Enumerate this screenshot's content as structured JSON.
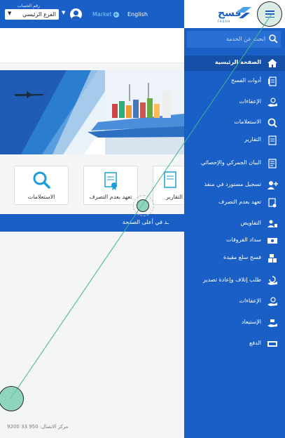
{
  "topbar": {
    "branch_label": "رقم الحساب",
    "branch_value": "الفرع الرئيسي",
    "market_label": "Market",
    "language_label": "English"
  },
  "cards": [
    {
      "label": "الاستعلامات",
      "icon": "search-icon"
    },
    {
      "label": "تعهد بعدم التصرف",
      "icon": "document-ribbon-icon"
    },
    {
      "label": "التقارير",
      "icon": "report-icon"
    }
  ],
  "bluebar": {
    "text": "ـد في أعلى الصفحة"
  },
  "footer": {
    "phone": "مركز الاتصال: 950 33 9200"
  },
  "drawer": {
    "logo_arabic": "فسح",
    "logo_english": "FASAH",
    "search_placeholder": "ابحث عن الخدمة",
    "items": [
      {
        "label": "الصفحة الرئيسية",
        "icon": "home-icon",
        "active": true
      },
      {
        "label": "أدوات الفسح",
        "icon": "tools-doc-icon"
      },
      {
        "label": "الإعفاءات",
        "icon": "hand-coin-icon"
      },
      {
        "label": "الاستعلامات",
        "icon": "search-icon"
      },
      {
        "label": "التقارير",
        "icon": "report-icon"
      },
      {
        "label": "البيان الجمركي والإحصائي",
        "icon": "customs-doc-icon"
      },
      {
        "label": "تسجيل مستورد في منفذ",
        "icon": "add-user-icon"
      },
      {
        "label": "تعهد بعدم التصرف",
        "icon": "pledge-doc-icon"
      },
      {
        "label": "التفاويض",
        "icon": "delegation-icon"
      },
      {
        "label": "سداد الفروقات",
        "icon": "cash-icon"
      },
      {
        "label": "فسح سلع مقيدة",
        "icon": "restricted-goods-icon"
      },
      {
        "label": "طلب إتلاف وإعادة تصدير",
        "icon": "hand-refresh-icon"
      },
      {
        "label": "الإعفاءات",
        "icon": "hand-coin-icon"
      },
      {
        "label": "الإستيعاد",
        "icon": "hand-return-icon"
      },
      {
        "label": "الدفع",
        "icon": "payment-icon"
      }
    ]
  },
  "colors": {
    "primary": "#1a5fc6",
    "active": "#154fa8",
    "accent": "#7fd1ff"
  }
}
